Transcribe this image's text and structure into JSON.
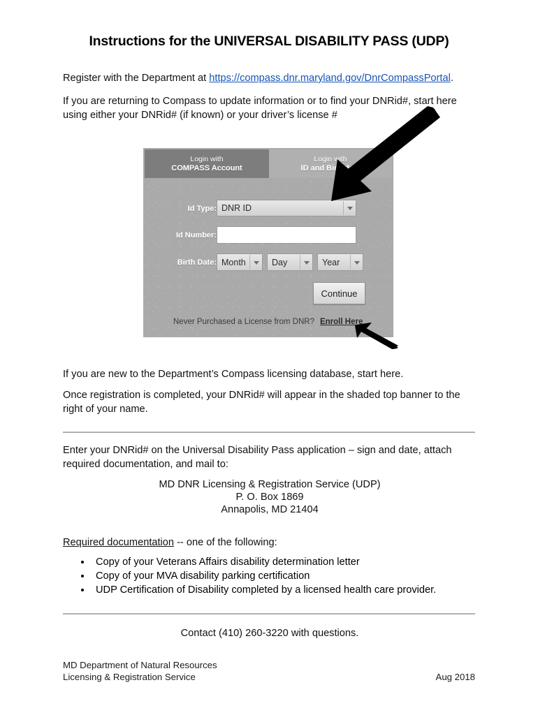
{
  "document": {
    "title": "Instructions for the UNIVERSAL DISABILITY PASS (UDP)",
    "intro": {
      "prefix": "Register with the Department at ",
      "link_text": "https://compass.dnr.maryland.gov/DnrCompassPortal",
      "suffix": "."
    },
    "returning_user_note": "If you are returning to Compass to update information or to find your DNRid#, start here using either your DNRid# (if known) or your driver’s license #",
    "new_user_note": "If you are new to the Department’s Compass licensing database, start here.",
    "registration_note": "Once registration is completed, your DNRid# will appear in the shaded top banner to the right of your name.",
    "mail_instruction": "Enter your DNRid# on the Universal Disability Pass application – sign and date, attach required documentation, and mail to:",
    "mailing_address": [
      "MD DNR Licensing & Registration Service (UDP)",
      "P. O. Box 1869",
      "Annapolis, MD  21404"
    ],
    "required_docs": {
      "heading_underlined": "Required documentation",
      "heading_rest": " -- one of the following:",
      "items": [
        "Copy of your Veterans Affairs disability determination letter",
        "Copy of your MVA disability parking certification",
        "UDP Certification of Disability completed by a licensed health care provider."
      ]
    },
    "contact_line": "Contact (410) 260-3220 with questions.",
    "footer": {
      "org_line1": "MD Department of Natural Resources",
      "org_line2": "Licensing & Registration Service",
      "date": "Aug 2018"
    }
  },
  "screenshot": {
    "tabs": [
      {
        "line1": "Login with",
        "line2": "COMPASS Account",
        "state": "inactive"
      },
      {
        "line1": "Login with",
        "line2": "ID and Birthdate",
        "state": "active"
      }
    ],
    "fields": {
      "id_type_label": "Id Type:",
      "id_type_value": "DNR ID",
      "id_number_label": "Id Number:",
      "id_number_value": "",
      "id_number_placeholder": "",
      "birth_date_label": "Birth Date:",
      "birth_month_value": "Month",
      "birth_day_value": "Day",
      "birth_year_value": "Year"
    },
    "continue_label": "Continue",
    "enroll_prompt": "Never Purchased a License from DNR?",
    "enroll_link": "Enroll Here",
    "colors": {
      "panel": "#aaaaaa",
      "tab_inactive": "#7d7d7d",
      "tab_active": "#b0b0b0",
      "arrow": "#000000",
      "link": "#1554b5"
    }
  }
}
